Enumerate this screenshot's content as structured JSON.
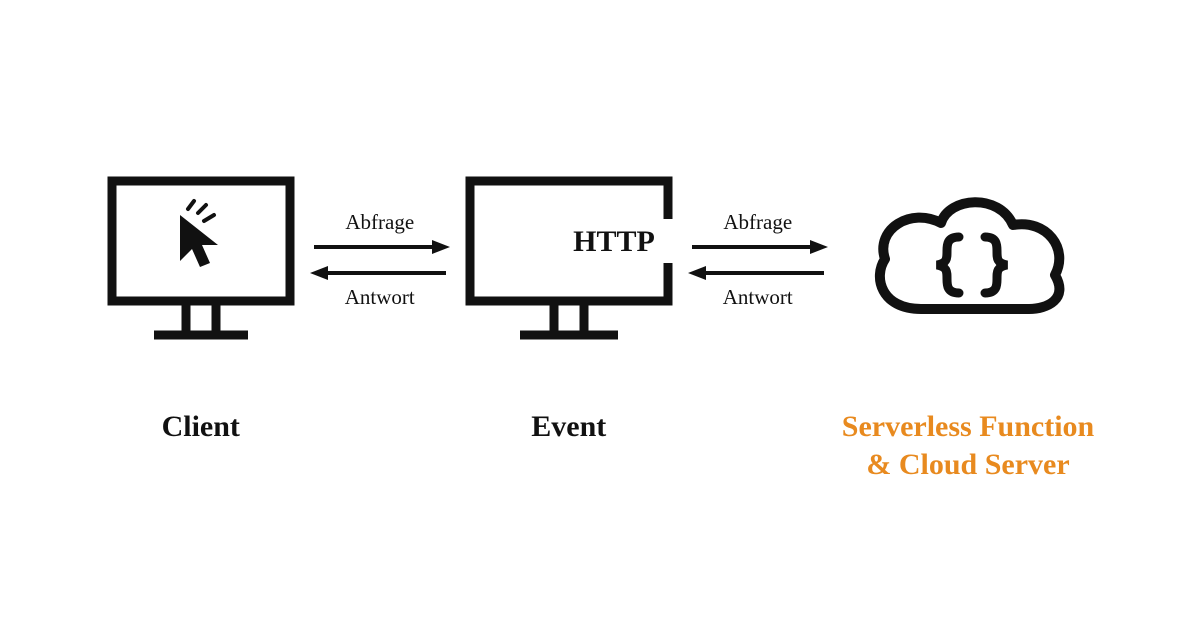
{
  "nodes": {
    "client": {
      "label": "Client"
    },
    "event": {
      "label": "Event",
      "http_text": "HTTP"
    },
    "cloud": {
      "label_line1": "Serverless Function",
      "label_line2": "& Cloud Server"
    }
  },
  "arrows": {
    "request_label": "Abfrage",
    "response_label": "Antwort"
  },
  "colors": {
    "stroke": "#111111",
    "accent": "#E88A1F"
  }
}
